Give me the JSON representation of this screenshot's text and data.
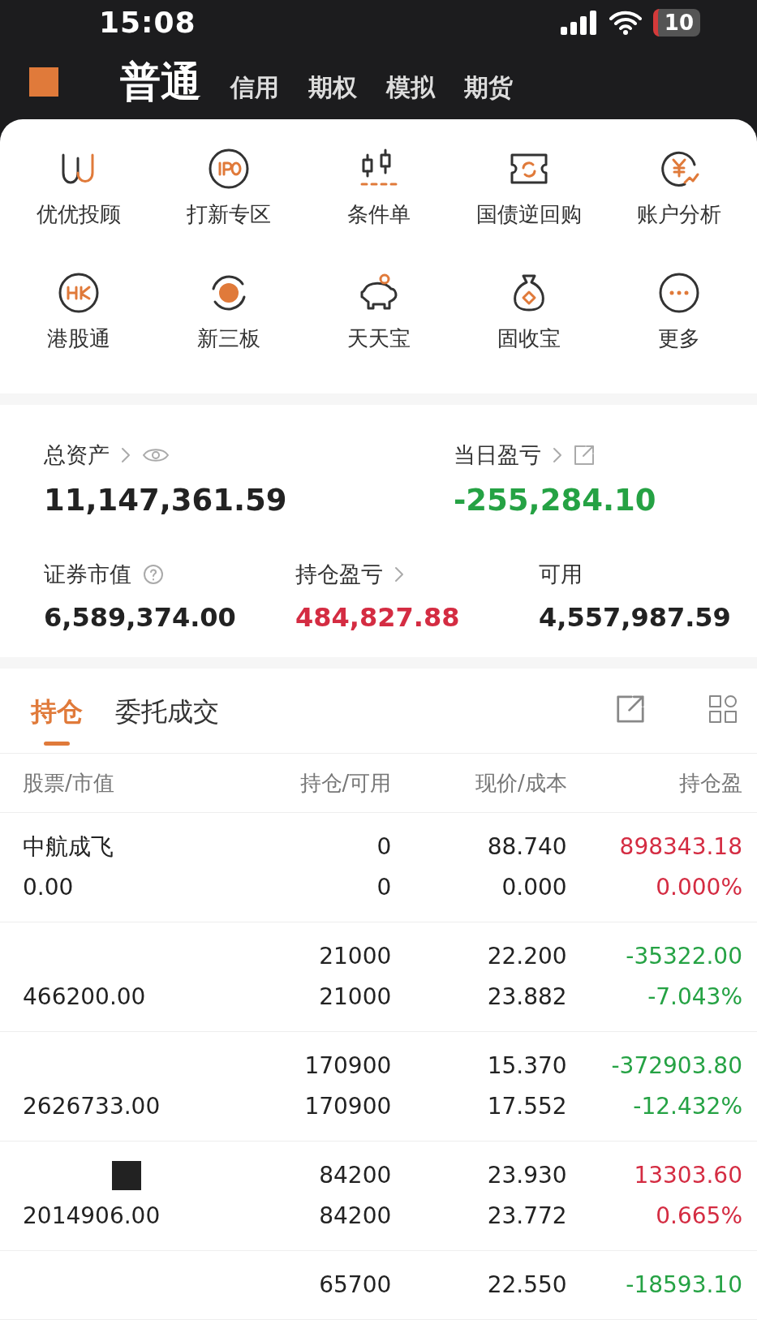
{
  "status_bar": {
    "time": "15:08",
    "battery": "10"
  },
  "account_tabs": [
    {
      "label": "普通",
      "selected": true
    },
    {
      "label": "信用",
      "selected": false
    },
    {
      "label": "期权",
      "selected": false
    },
    {
      "label": "模拟",
      "selected": false
    },
    {
      "label": "期货",
      "selected": false
    }
  ],
  "shortcuts": [
    {
      "kind": "u",
      "label": "优优投顾"
    },
    {
      "kind": "ipo",
      "label": "打新专区"
    },
    {
      "kind": "candle",
      "label": "条件单"
    },
    {
      "kind": "ticket",
      "label": "国债逆回购"
    },
    {
      "kind": "yen",
      "label": "账户分析"
    },
    {
      "kind": "hk",
      "label": "港股通"
    },
    {
      "kind": "new",
      "label": "新三板"
    },
    {
      "kind": "piggy",
      "label": "天天宝"
    },
    {
      "kind": "bag",
      "label": "固收宝"
    },
    {
      "kind": "more",
      "label": "更多"
    }
  ],
  "summary_top": [
    {
      "kind": "hidable",
      "label": "总资产",
      "value": "11,147,361.59",
      "color": "#222222"
    },
    {
      "kind": "shareable",
      "label": "当日盈亏",
      "value": "-255,284.10",
      "color": "#25a244"
    }
  ],
  "summary_bottom": [
    {
      "kind": "help",
      "label": "证券市值",
      "value": "6,589,374.00",
      "color": "#222222"
    },
    {
      "kind": "link",
      "label": "持仓盈亏",
      "value": "484,827.88",
      "color": "#d42c42"
    },
    {
      "kind": "plain",
      "label": "可用",
      "value": "4,557,987.59",
      "color": "#222222"
    }
  ],
  "position_tabs": [
    {
      "label": "持仓",
      "selected": true
    },
    {
      "label": "委托成交",
      "selected": false
    }
  ],
  "table": {
    "columns": [
      "股票/市值",
      "持仓/可用",
      "现价/成本",
      "持仓盈"
    ],
    "rows": [
      {
        "name": "中航成飞",
        "market_value": "0.00",
        "holding": "0",
        "available": "0",
        "price": "88.740",
        "cost": "0.000",
        "profit": "898343.18",
        "profit_pct": "0.000%",
        "color": "#d42c42"
      },
      {
        "market_value": "466200.00",
        "holding": "21000",
        "available": "21000",
        "price": "22.200",
        "cost": "23.882",
        "profit": "-35322.00",
        "profit_pct": "-7.043%",
        "color": "#25a244"
      },
      {
        "market_value": "2626733.00",
        "holding": "170900",
        "available": "170900",
        "price": "15.370",
        "cost": "17.552",
        "profit": "-372903.80",
        "profit_pct": "-12.432%",
        "color": "#25a244"
      },
      {
        "market_value": "2014906.00",
        "holding": "84200",
        "available": "84200",
        "price": "23.930",
        "cost": "23.772",
        "profit": "13303.60",
        "profit_pct": "0.665%",
        "color": "#d42c42",
        "redacted": true
      },
      {
        "holding": "65700",
        "price": "22.550",
        "profit": "-18593.10",
        "color": "#25a244"
      }
    ]
  }
}
